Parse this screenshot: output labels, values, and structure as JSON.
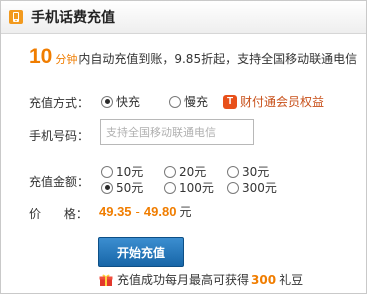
{
  "header": {
    "title": "手机话费充值",
    "icon": "mobile-phone-icon"
  },
  "promo": {
    "minutes": "10",
    "unit": "分钟",
    "text": "内自动充值到账，9.85折起，支持全国移动联通电信"
  },
  "method": {
    "label": "充值方式：",
    "options": [
      {
        "label": "快充",
        "checked": true
      },
      {
        "label": "慢充",
        "checked": false
      }
    ],
    "badge": {
      "icon_text": "T",
      "label": "财付通会员权益",
      "icon": "tenpay-badge-icon"
    }
  },
  "phone": {
    "label": "手机号码：",
    "value": "",
    "placeholder": "支持全国移动联通电信"
  },
  "amount": {
    "label": "充值金额：",
    "options": [
      {
        "label": "10元",
        "checked": false
      },
      {
        "label": "20元",
        "checked": false
      },
      {
        "label": "30元",
        "checked": false
      },
      {
        "label": "50元",
        "checked": true
      },
      {
        "label": "100元",
        "checked": false
      },
      {
        "label": "300元",
        "checked": false
      }
    ]
  },
  "price": {
    "label": "价      格：",
    "min": "49.35",
    "separator": "-",
    "max": "49.80",
    "unit": "元"
  },
  "submit_label": "开始充值",
  "gift": {
    "text": "充值成功每月最高可获得",
    "amount": "300",
    "unit": "礼豆",
    "icon": "gift-icon"
  },
  "colors": {
    "accent": "#f07d00",
    "button": "#1766a8",
    "badge": "#e8501a"
  }
}
